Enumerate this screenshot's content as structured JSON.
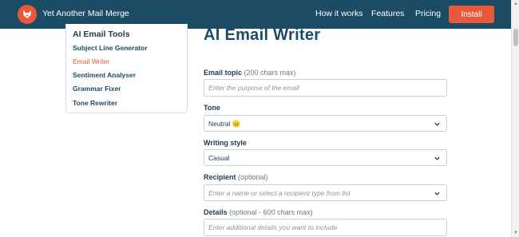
{
  "header": {
    "brand": "Yet Another Mail Merge",
    "nav": {
      "how_it_works": "How it works",
      "features": "Features",
      "pricing": "Pricing"
    },
    "install_label": "Install",
    "colors": {
      "bar": "#1c4b66",
      "accent": "#e8593c"
    }
  },
  "sidebar": {
    "title": "AI Email Tools",
    "items": [
      {
        "label": "Subject Line Generator",
        "active": false
      },
      {
        "label": "Email Writer",
        "active": true
      },
      {
        "label": "Sentiment Analyser",
        "active": false
      },
      {
        "label": "Grammar Fixer",
        "active": false
      },
      {
        "label": "Tone Rewriter",
        "active": false
      }
    ]
  },
  "main": {
    "title": "AI Email Writer",
    "topic": {
      "label": "Email topic",
      "hint": "(200 chars max)",
      "placeholder": "Enter the purpose of the email",
      "value": ""
    },
    "tone": {
      "label": "Tone",
      "value": "Neutral 😐"
    },
    "style": {
      "label": "Writing style",
      "value": "Casual"
    },
    "recipient": {
      "label": "Recipient",
      "hint": "(optional)",
      "placeholder": "Enter a name or select a recipient type from list"
    },
    "details": {
      "label": "Details",
      "hint": "(optional - 600 chars max)",
      "placeholder": "Enter additional details you want to include",
      "value": ""
    }
  }
}
